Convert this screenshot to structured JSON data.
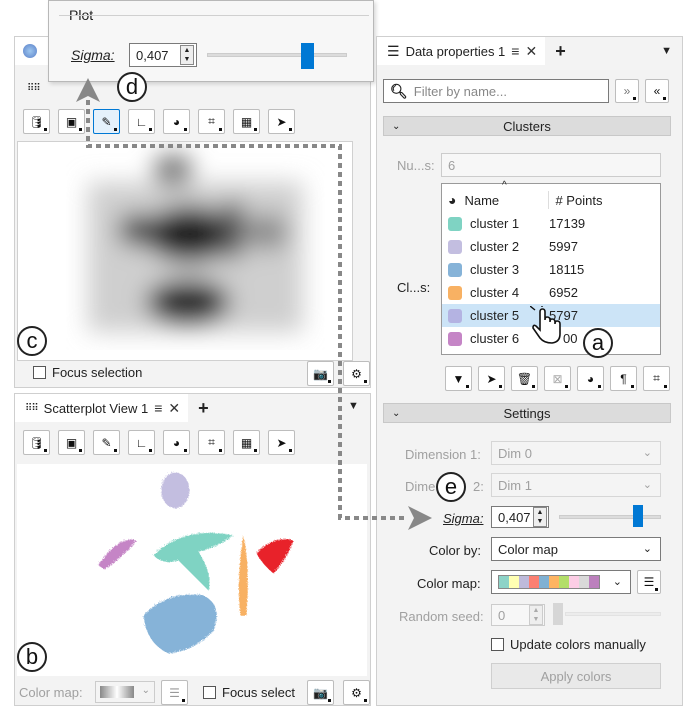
{
  "plot_popup": {
    "title": "Plot",
    "sigma_label": "Sigma:",
    "sigma_value": "0,407",
    "sigma_slider_level": 0.78
  },
  "top_view": {
    "toolbar_icons": [
      "database-icon",
      "image-icon",
      "brush-icon",
      "axes-icon",
      "palette-icon",
      "crop-icon",
      "grid-icon",
      "pointer-icon"
    ],
    "focus_selection_label": "Focus selection"
  },
  "scatter_view": {
    "tab_label": "Scatterplot View 1",
    "toolbar_icons": [
      "database-icon",
      "image-icon",
      "brush-icon",
      "axes-icon",
      "palette-icon",
      "crop-icon",
      "grid-icon",
      "pointer-icon"
    ],
    "color_map_label": "Color map:",
    "focus_select_label": "Focus select"
  },
  "data_properties": {
    "tab_label": "Data properties 1",
    "filter_placeholder": "Filter by name...",
    "clusters_header": "Clusters",
    "num_label": "Nu...s:",
    "num_value": "6",
    "clusters_label": "Cl...s:",
    "table_headers": {
      "name": "Name",
      "points": "# Points"
    },
    "clusters": [
      {
        "name": "cluster 1",
        "points": "17139",
        "color": "#7fd3c3"
      },
      {
        "name": "cluster 2",
        "points": "5997",
        "color": "#c3bee0"
      },
      {
        "name": "cluster 3",
        "points": "18115",
        "color": "#86b3d8"
      },
      {
        "name": "cluster 4",
        "points": "6952",
        "color": "#f8b163"
      },
      {
        "name": "cluster 5",
        "points": "5797",
        "color": "#b4b3e2"
      },
      {
        "name": "cluster 6",
        "points": "00",
        "color": "#c585c6"
      }
    ],
    "selected_index": 4,
    "settings_header": "Settings",
    "dim1_label": "Dimension 1:",
    "dim1_value": "Dim 0",
    "dim2_label": "Dime",
    "dim2_label_tail": "2:",
    "dim2_value": "Dim 1",
    "sigma_label": "Sigma:",
    "sigma_value": "0,407",
    "sigma_slider_level": 0.78,
    "color_by_label": "Color by:",
    "color_by_value": "Color map",
    "color_map_label": "Color map:",
    "colormap_colors": [
      "#8dd3c7",
      "#ffffb3",
      "#bebada",
      "#fb8072",
      "#80b1d3",
      "#fdb462",
      "#b3de69",
      "#fccde5",
      "#d9d9d9",
      "#bc80bd"
    ],
    "random_seed_label": "Random seed:",
    "random_seed_value": "0",
    "update_colors_label": "Update colors manually",
    "apply_colors_label": "Apply colors"
  },
  "annotations": {
    "a": "a",
    "b": "b",
    "c": "c",
    "d": "d",
    "e": "e"
  }
}
